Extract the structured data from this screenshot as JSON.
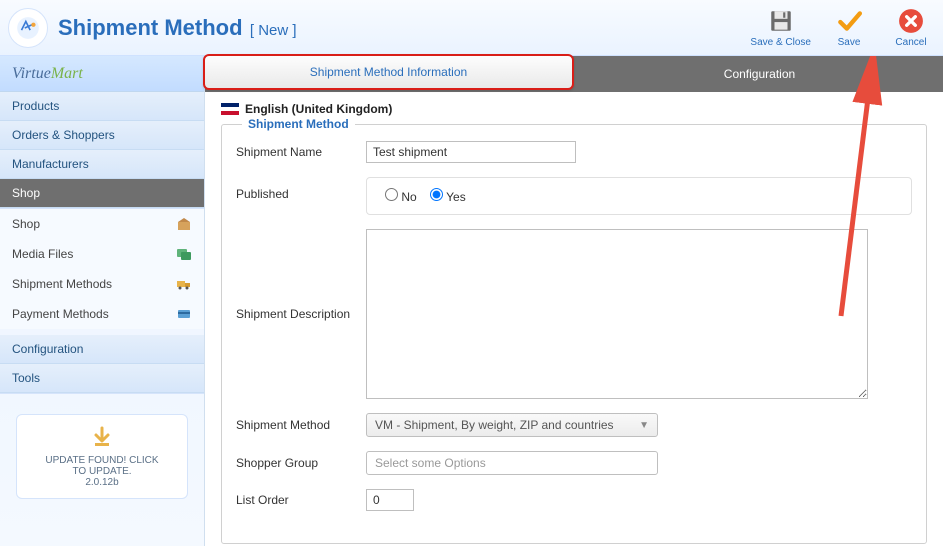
{
  "header": {
    "title": "Shipment Method",
    "subtitle": "[ New ]"
  },
  "toolbar": {
    "save_close": "Save & Close",
    "save": "Save",
    "cancel": "Cancel"
  },
  "sidebar": {
    "brand_left": "Virtue",
    "brand_right": "Mart",
    "items": [
      {
        "label": "Products"
      },
      {
        "label": "Orders & Shoppers"
      },
      {
        "label": "Manufacturers"
      },
      {
        "label": "Shop"
      }
    ],
    "subitems": [
      {
        "label": "Shop"
      },
      {
        "label": "Media Files"
      },
      {
        "label": "Shipment Methods"
      },
      {
        "label": "Payment Methods"
      }
    ],
    "items2": [
      {
        "label": "Configuration"
      },
      {
        "label": "Tools"
      }
    ],
    "update": {
      "line1": "UPDATE FOUND! CLICK",
      "line2": "TO UPDATE.",
      "line3": "2.0.12b"
    }
  },
  "tabs": {
    "info": "Shipment Method Information",
    "config": "Configuration"
  },
  "form": {
    "language": "English (United Kingdom)",
    "legend": "Shipment Method",
    "shipname_label": "Shipment Name",
    "shipname_value": "Test shipment",
    "published_label": "Published",
    "no": "No",
    "yes": "Yes",
    "published_value": "yes",
    "desc_label": "Shipment Description",
    "desc_value": "",
    "method_label": "Shipment Method",
    "method_value": "VM - Shipment, By weight, ZIP and countries",
    "group_label": "Shopper Group",
    "group_placeholder": "Select some Options",
    "order_label": "List Order",
    "order_value": "0"
  }
}
